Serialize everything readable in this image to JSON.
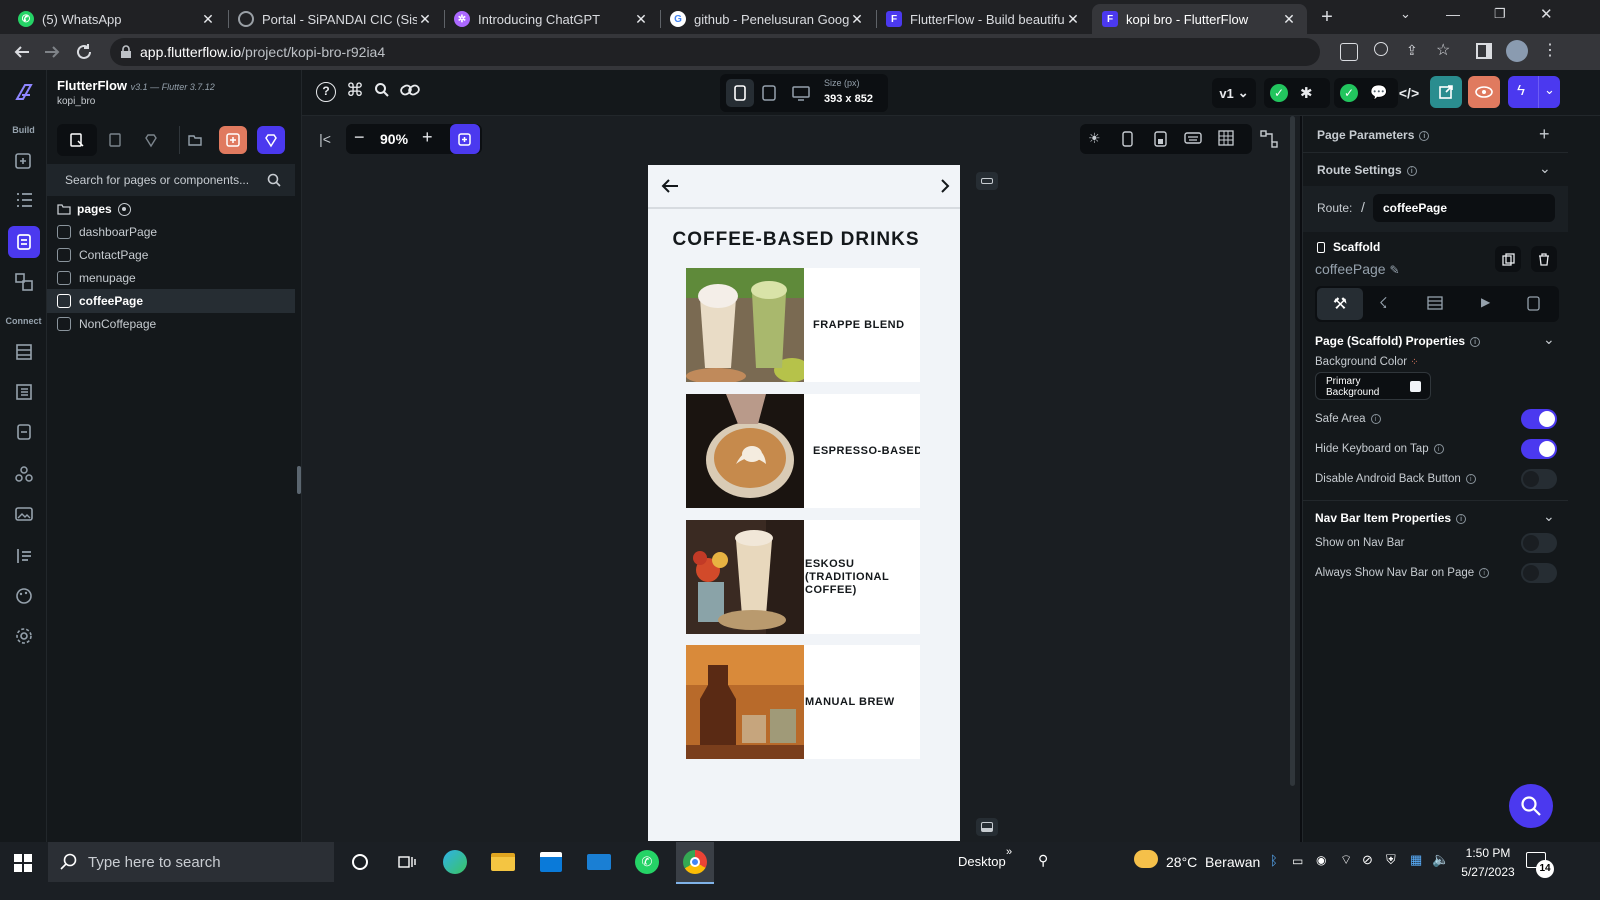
{
  "browser": {
    "tabs": [
      {
        "title": "(5) WhatsApp",
        "favicon": "whatsapp-icon",
        "active": false
      },
      {
        "title": "Portal - SiPANDAI CIC (Sistem",
        "favicon": "globe-icon",
        "active": false
      },
      {
        "title": "Introducing ChatGPT",
        "favicon": "openai-icon",
        "active": false
      },
      {
        "title": "github - Penelusuran Google",
        "favicon": "google-icon",
        "active": false
      },
      {
        "title": "FlutterFlow - Build beautiful, m",
        "favicon": "flutterflow-icon",
        "active": false
      },
      {
        "title": "kopi bro - FlutterFlow",
        "favicon": "flutterflow-icon",
        "active": true
      }
    ],
    "url_host": "app.flutterflow.io",
    "url_path": "/project/kopi-bro-r92ia4"
  },
  "app": {
    "brand": "FlutterFlow",
    "version": "v3.1 — Flutter 3.7.12",
    "project": "kopi_bro",
    "rail_build": "Build",
    "rail_connect": "Connect"
  },
  "pages_panel": {
    "search_placeholder": "Search for pages or components...",
    "folder": "pages",
    "items": [
      "dashboarPage",
      "ContactPage",
      "menupage",
      "coffeePage",
      "NonCoffepage"
    ],
    "selected": "coffeePage"
  },
  "toolbar": {
    "zoom": "90%",
    "size_label": "Size (px)",
    "size_value": "393 x 852",
    "version": "v1"
  },
  "phone": {
    "title": "COFFEE-BASED DRINKS",
    "cards": [
      {
        "label": "FRAPPE BLEND"
      },
      {
        "label": "ESPRESSO-BASED"
      },
      {
        "label": "ESKOSU (TRADITIONAL COFFEE)"
      },
      {
        "label": "MANUAL BREW"
      }
    ]
  },
  "right_panel": {
    "page_params": "Page Parameters",
    "route_settings": "Route Settings",
    "route_label": "Route:",
    "route_slash": "/",
    "route_value": "coffeePage",
    "scaffold": "Scaffold",
    "scaffold_name": "coffeePage",
    "props_header": "Page (Scaffold) Properties",
    "bg_color_label": "Background Color",
    "bg_color_value": "Primary Background",
    "safe_area": "Safe Area",
    "safe_area_on": true,
    "hide_keyboard": "Hide Keyboard on Tap",
    "hide_keyboard_on": true,
    "disable_back": "Disable Android Back Button",
    "disable_back_on": false,
    "nav_header": "Nav Bar Item Properties",
    "show_nav": "Show on Nav Bar",
    "show_nav_on": false,
    "always_show": "Always Show Nav Bar on Page",
    "always_show_on": false
  },
  "taskbar": {
    "search_placeholder": "Type here to search",
    "desktop": "Desktop",
    "weather": "28°C  Berawan",
    "time": "1:50 PM",
    "date": "5/27/2023",
    "notif_count": "14"
  },
  "colors": {
    "accent": "#4b39ef",
    "bg_dark": "#14181b",
    "canvas": "#1a1e22",
    "orange": "#e07a5f",
    "green": "#22c55e"
  }
}
